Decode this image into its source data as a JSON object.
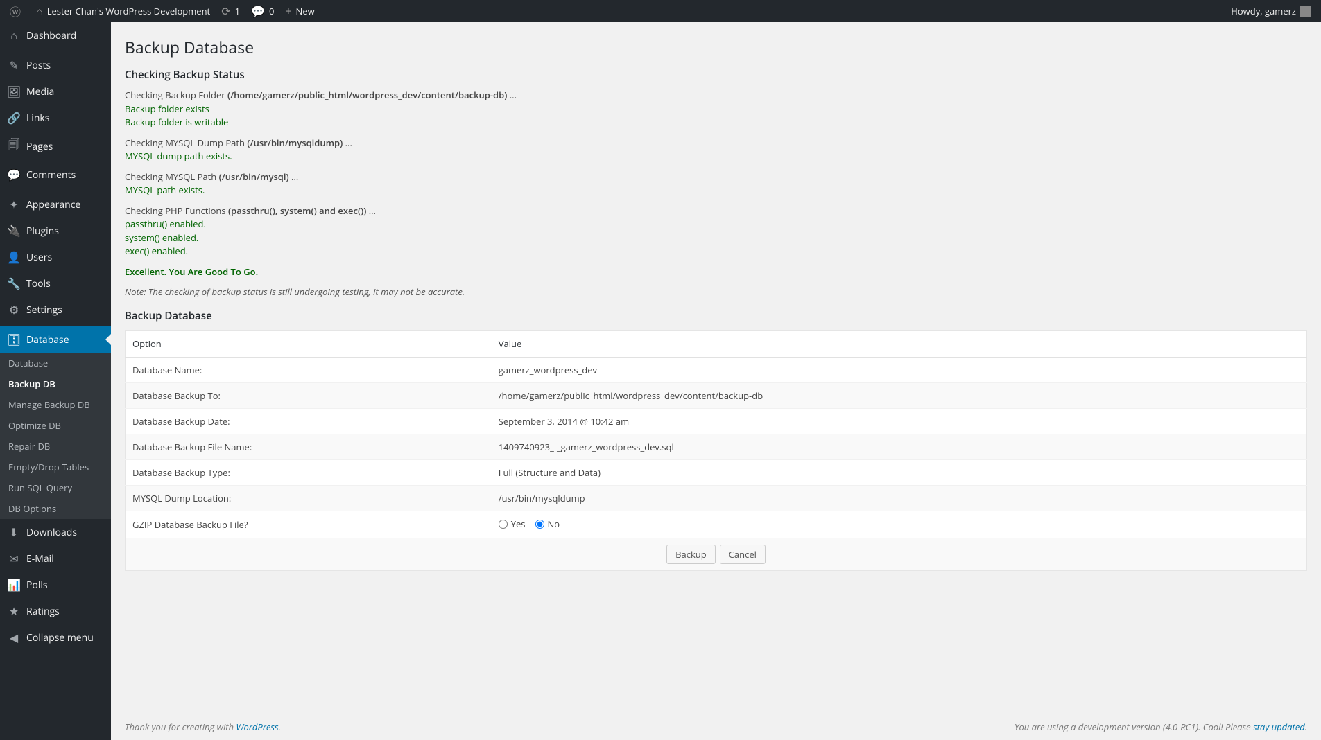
{
  "adminbar": {
    "site_title": "Lester Chan's WordPress Development",
    "updates_count": "1",
    "comments_count": "0",
    "new_label": "New",
    "howdy": "Howdy, gamerz"
  },
  "sidebar": {
    "items": [
      {
        "icon": "⌂",
        "label": "Dashboard"
      },
      {
        "icon": "✎",
        "label": "Posts"
      },
      {
        "icon": "🖼",
        "label": "Media"
      },
      {
        "icon": "🔗",
        "label": "Links"
      },
      {
        "icon": "🗐",
        "label": "Pages"
      },
      {
        "icon": "💬",
        "label": "Comments"
      },
      {
        "icon": "✦",
        "label": "Appearance"
      },
      {
        "icon": "🔌",
        "label": "Plugins"
      },
      {
        "icon": "👤",
        "label": "Users"
      },
      {
        "icon": "🔧",
        "label": "Tools"
      },
      {
        "icon": "⚙",
        "label": "Settings"
      },
      {
        "icon": "🗄",
        "label": "Database",
        "current": true
      },
      {
        "icon": "⬇",
        "label": "Downloads"
      },
      {
        "icon": "✉",
        "label": "E-Mail"
      },
      {
        "icon": "📊",
        "label": "Polls"
      },
      {
        "icon": "★",
        "label": "Ratings"
      },
      {
        "icon": "◀",
        "label": "Collapse menu"
      }
    ],
    "submenu": [
      {
        "label": "Database"
      },
      {
        "label": "Backup DB",
        "current": true
      },
      {
        "label": "Manage Backup DB"
      },
      {
        "label": "Optimize DB"
      },
      {
        "label": "Repair DB"
      },
      {
        "label": "Empty/Drop Tables"
      },
      {
        "label": "Run SQL Query"
      },
      {
        "label": "DB Options"
      }
    ]
  },
  "page": {
    "title": "Backup Database",
    "status_heading": "Checking Backup Status",
    "status": [
      {
        "lead": "Checking Backup Folder ",
        "bold": "(/home/gamerz/public_html/wordpress_dev/content/backup-db)",
        "trail": " ...",
        "oks": [
          "Backup folder exists",
          "Backup folder is writable"
        ]
      },
      {
        "lead": "Checking MYSQL Dump Path ",
        "bold": "(/usr/bin/mysqldump)",
        "trail": " ...",
        "oks": [
          "MYSQL dump path exists."
        ]
      },
      {
        "lead": "Checking MYSQL Path ",
        "bold": "(/usr/bin/mysql)",
        "trail": " ...",
        "oks": [
          "MYSQL path exists."
        ]
      },
      {
        "lead": "Checking PHP Functions ",
        "bold": "(passthru(), system() and exec())",
        "trail": " ...",
        "oks": [
          "passthru() enabled.",
          "system() enabled.",
          "exec() enabled."
        ]
      }
    ],
    "excellent": "Excellent. You Are Good To Go.",
    "note": "Note: The checking of backup status is still undergoing testing, it may not be accurate.",
    "backup_heading": "Backup Database",
    "table": {
      "headers": {
        "option": "Option",
        "value": "Value"
      },
      "rows": [
        {
          "option": "Database Name:",
          "value": "gamerz_wordpress_dev"
        },
        {
          "option": "Database Backup To:",
          "value": "/home/gamerz/public_html/wordpress_dev/content/backup-db"
        },
        {
          "option": "Database Backup Date:",
          "value": "September 3, 2014 @ 10:42 am"
        },
        {
          "option": "Database Backup File Name:",
          "value": "1409740923_-_gamerz_wordpress_dev.sql"
        },
        {
          "option": "Database Backup Type:",
          "value": "Full (Structure and Data)"
        },
        {
          "option": "MYSQL Dump Location:",
          "value": "/usr/bin/mysqldump"
        }
      ],
      "gzip": {
        "option": "GZIP Database Backup File?",
        "yes": "Yes",
        "no": "No"
      }
    },
    "buttons": {
      "backup": "Backup",
      "cancel": "Cancel"
    }
  },
  "footer": {
    "thank_pre": "Thank you for creating with ",
    "thank_link": "WordPress",
    "thank_post": ".",
    "version_pre": "You are using a development version (4.0-RC1). Cool! Please ",
    "version_link": "stay updated",
    "version_post": "."
  }
}
